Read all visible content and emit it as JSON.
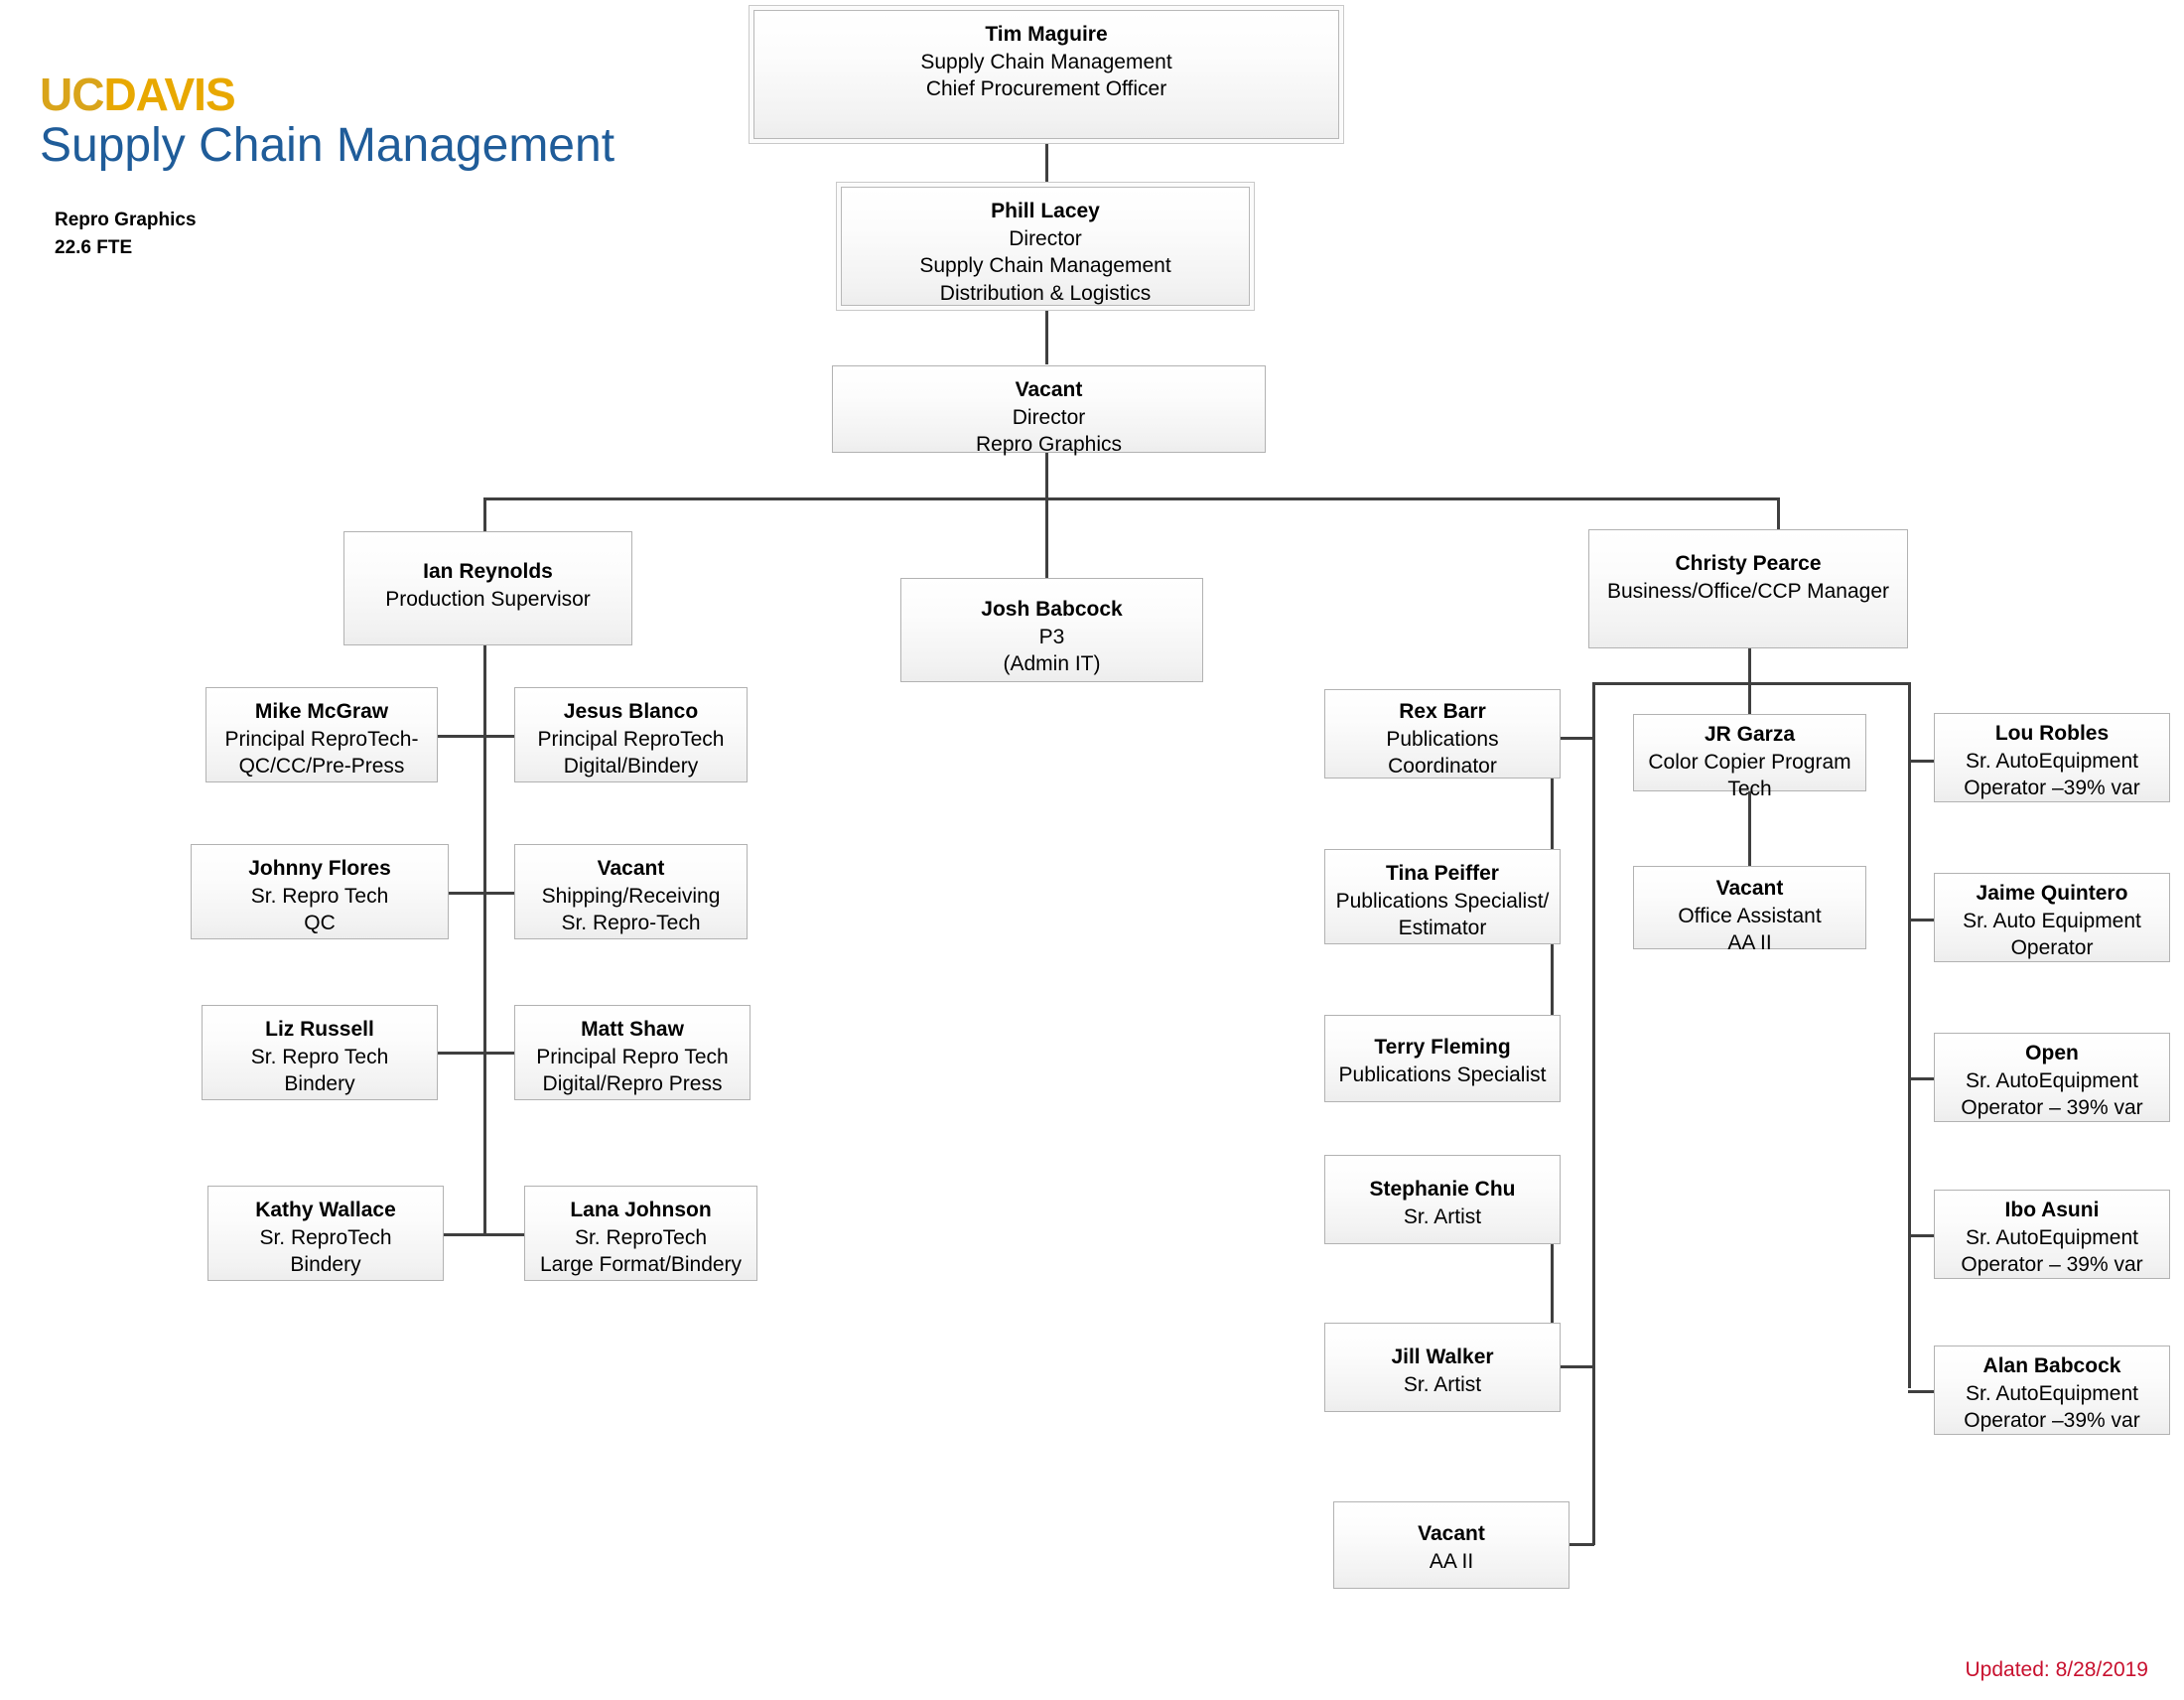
{
  "branding": {
    "logo_uc": "UC",
    "logo_davis": "DAVIS",
    "logo_subtitle": "Supply Chain Management",
    "dept_name": "Repro Graphics",
    "dept_fte": "22.6 FTE"
  },
  "footer": {
    "updated": "Updated: 8/28/2019"
  },
  "colors": {
    "logo_uc": "#d9a41a",
    "logo_davis": "#e8a800",
    "logo_subtitle": "#1f5c99",
    "updated_text": "#c8102e",
    "box_border": "#b2b2b2",
    "connector": "#3f3f3f"
  },
  "nodes": {
    "tim_maguire": {
      "name": "Tim Maguire",
      "line2": "Supply Chain Management",
      "line3": "Chief Procurement Officer"
    },
    "phill_lacey": {
      "name": "Phill Lacey",
      "line2": "Director",
      "line3": "Supply Chain Management",
      "line4": "Distribution & Logistics"
    },
    "vacant_director": {
      "name": "Vacant",
      "line2": "Director",
      "line3": "Repro Graphics"
    },
    "ian_reynolds": {
      "name": "Ian Reynolds",
      "line2": "Production Supervisor"
    },
    "josh_babcock": {
      "name": "Josh Babcock",
      "line2": "P3",
      "line3": "(Admin IT)"
    },
    "christy_pearce": {
      "name": "Christy Pearce",
      "line2": "Business/Office/CCP Manager"
    },
    "mike_mcgraw": {
      "name": "Mike McGraw",
      "line2": "Principal ReproTech-",
      "line3": "QC/CC/Pre-Press"
    },
    "jesus_blanco": {
      "name": "Jesus Blanco",
      "line2": "Principal ReproTech",
      "line3": "Digital/Bindery"
    },
    "johnny_flores": {
      "name": "Johnny Flores",
      "line2": "Sr. Repro Tech",
      "line3": "QC"
    },
    "vacant_shipping": {
      "name": "Vacant",
      "line2": "Shipping/Receiving",
      "line3": "Sr. Repro-Tech"
    },
    "liz_russell": {
      "name": "Liz Russell",
      "line2": "Sr. Repro Tech",
      "line3": "Bindery"
    },
    "matt_shaw": {
      "name": "Matt Shaw",
      "line2": "Principal Repro Tech",
      "line3": "Digital/Repro Press"
    },
    "kathy_wallace": {
      "name": "Kathy Wallace",
      "line2": "Sr. ReproTech",
      "line3": "Bindery"
    },
    "lana_johnson": {
      "name": "Lana Johnson",
      "line2": "Sr. ReproTech",
      "line3": "Large Format/Bindery"
    },
    "rex_barr": {
      "name": "Rex Barr",
      "line2": "Publications",
      "line3": "Coordinator"
    },
    "tina_peiffer": {
      "name": "Tina Peiffer",
      "line2": "Publications Specialist/",
      "line3": "Estimator"
    },
    "terry_fleming": {
      "name": "Terry Fleming",
      "line2": "Publications Specialist"
    },
    "stephanie_chu": {
      "name": "Stephanie Chu",
      "line2": "Sr. Artist"
    },
    "jill_walker": {
      "name": "Jill Walker",
      "line2": "Sr. Artist"
    },
    "vacant_aa2": {
      "name": "Vacant",
      "line2": "AA II"
    },
    "jr_garza": {
      "name": "JR Garza",
      "line2": "Color Copier Program",
      "line3": "Tech"
    },
    "vacant_office": {
      "name": "Vacant",
      "line2": "Office Assistant",
      "line3": "AA II"
    },
    "lou_robles": {
      "name": "Lou Robles",
      "line2": "Sr. AutoEquipment",
      "line3": "Operator –39% var"
    },
    "jaime_quintero": {
      "name": "Jaime Quintero",
      "line2": "Sr. Auto Equipment",
      "line3": "Operator"
    },
    "open_operator": {
      "name": "Open",
      "line2": "Sr. AutoEquipment",
      "line3": "Operator – 39% var"
    },
    "ibo_asuni": {
      "name": "Ibo Asuni",
      "line2": "Sr. AutoEquipment",
      "line3": "Operator – 39% var"
    },
    "alan_babcock": {
      "name": "Alan Babcock",
      "line2": "Sr. AutoEquipment",
      "line3": "Operator –39% var"
    }
  }
}
